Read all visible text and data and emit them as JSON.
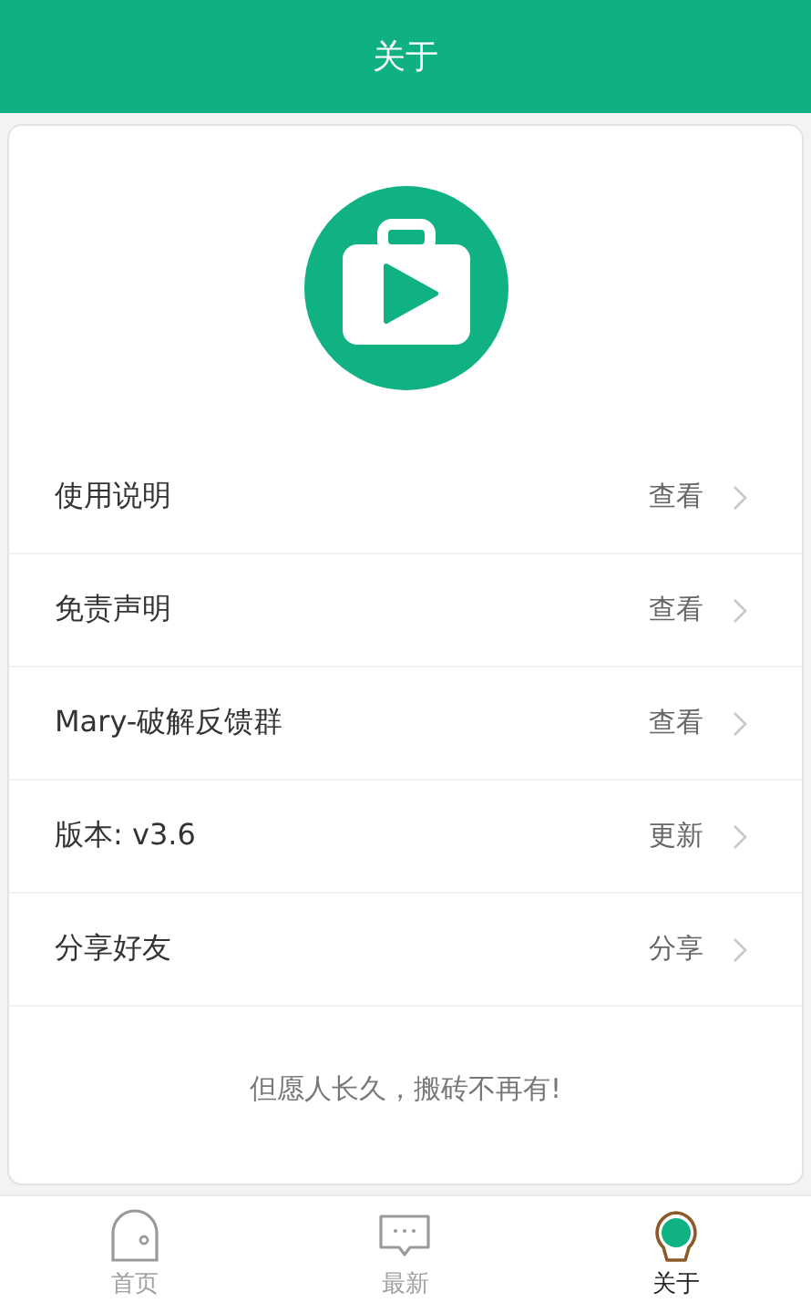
{
  "header": {
    "title": "关于"
  },
  "menu": [
    {
      "label": "使用说明",
      "action": "查看"
    },
    {
      "label": "免责声明",
      "action": "查看"
    },
    {
      "label": "Mary-破解反馈群",
      "action": "查看"
    },
    {
      "label": "版本: v3.6",
      "action": "更新"
    },
    {
      "label": "分享好友",
      "action": "分享"
    }
  ],
  "footer_text": "但愿人长久，搬砖不再有!",
  "tabs": [
    {
      "label": "首页",
      "kind": "home",
      "selected": false
    },
    {
      "label": "最新",
      "kind": "chat",
      "selected": false
    },
    {
      "label": "关于",
      "kind": "bulb",
      "selected": true
    }
  ]
}
